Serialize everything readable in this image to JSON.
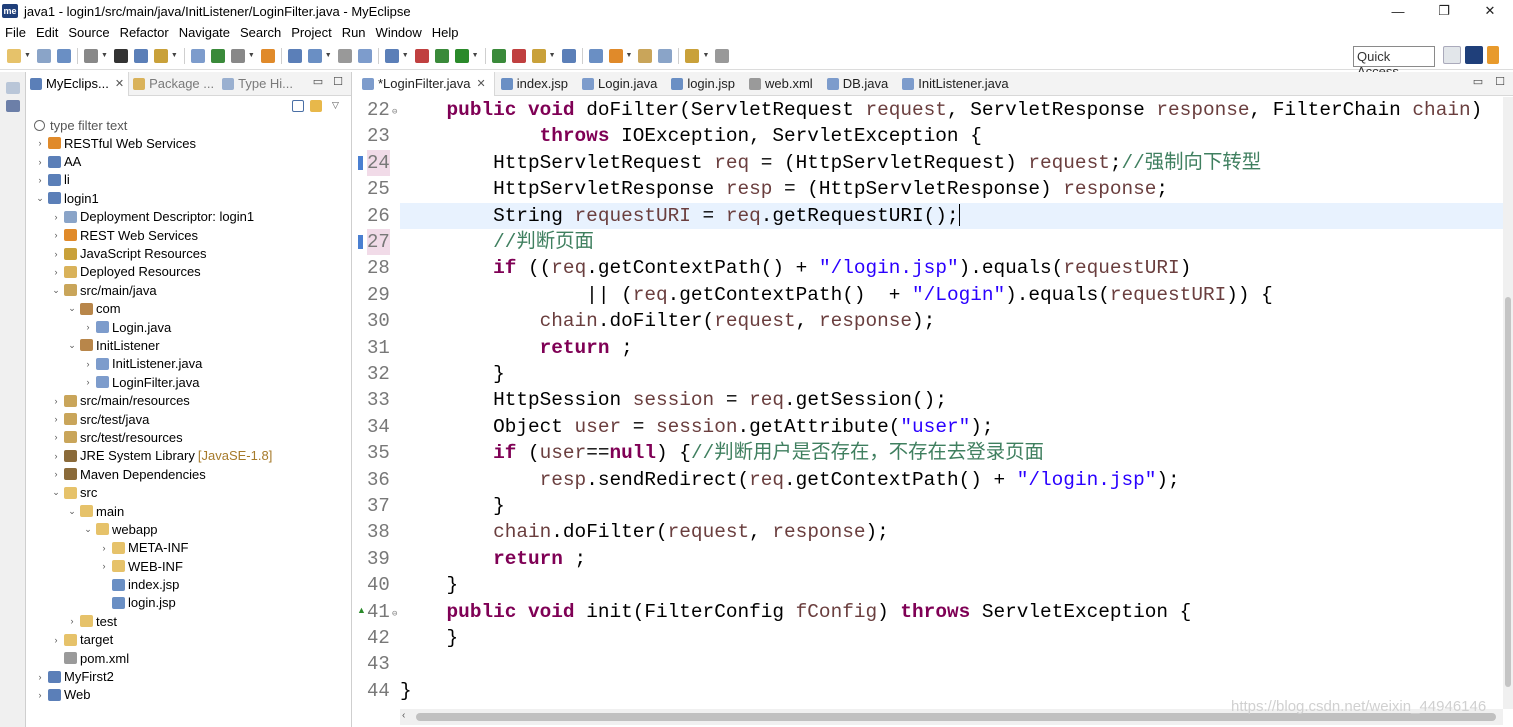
{
  "window": {
    "title": "java1 - login1/src/main/java/InitListener/LoginFilter.java - MyEclipse",
    "app_icon_text": "me",
    "controls": {
      "minimize": "—",
      "maximize": "❐",
      "close": "✕"
    }
  },
  "menu": [
    "File",
    "Edit",
    "Source",
    "Refactor",
    "Navigate",
    "Search",
    "Project",
    "Run",
    "Window",
    "Help"
  ],
  "toolbar": {
    "quick_access_label": "Quick Access"
  },
  "explorer": {
    "tabs": [
      {
        "label": "MyEclips...",
        "active": true
      },
      {
        "label": "Package ...",
        "active": false
      },
      {
        "label": "Type Hi...",
        "active": false
      }
    ],
    "filter_placeholder": "type filter text",
    "tree": [
      {
        "label": "RESTful Web Services",
        "depth": 0,
        "arrow": "›",
        "icon": "rest-icon"
      },
      {
        "label": "AA",
        "depth": 0,
        "arrow": "›",
        "icon": "web-project-icon"
      },
      {
        "label": "li",
        "depth": 0,
        "arrow": "›",
        "icon": "web-project-icon"
      },
      {
        "label": "login1",
        "depth": 0,
        "arrow": "⌄",
        "icon": "web-project-icon"
      },
      {
        "label": "Deployment Descriptor: login1",
        "depth": 1,
        "arrow": "›",
        "icon": "deployment-descriptor-icon"
      },
      {
        "label": "REST Web Services",
        "depth": 1,
        "arrow": "›",
        "icon": "rest-icon"
      },
      {
        "label": "JavaScript Resources",
        "depth": 1,
        "arrow": "›",
        "icon": "javascript-resources-icon"
      },
      {
        "label": "Deployed Resources",
        "depth": 1,
        "arrow": "›",
        "icon": "deployed-resources-icon"
      },
      {
        "label": "src/main/java",
        "depth": 1,
        "arrow": "⌄",
        "icon": "source-folder-icon"
      },
      {
        "label": "com",
        "depth": 2,
        "arrow": "⌄",
        "icon": "package-icon"
      },
      {
        "label": "Login.java",
        "depth": 3,
        "arrow": "›",
        "icon": "java-file-icon"
      },
      {
        "label": "InitListener",
        "depth": 2,
        "arrow": "⌄",
        "icon": "package-icon"
      },
      {
        "label": "InitListener.java",
        "depth": 3,
        "arrow": "›",
        "icon": "java-file-icon"
      },
      {
        "label": "LoginFilter.java",
        "depth": 3,
        "arrow": "›",
        "icon": "java-file-icon"
      },
      {
        "label": "src/main/resources",
        "depth": 1,
        "arrow": "›",
        "icon": "source-folder-icon"
      },
      {
        "label": "src/test/java",
        "depth": 1,
        "arrow": "›",
        "icon": "source-folder-icon"
      },
      {
        "label": "src/test/resources",
        "depth": 1,
        "arrow": "›",
        "icon": "source-folder-icon"
      },
      {
        "label": "JRE System Library",
        "suffix": "[JavaSE-1.8]",
        "depth": 1,
        "arrow": "›",
        "icon": "library-icon"
      },
      {
        "label": "Maven Dependencies",
        "depth": 1,
        "arrow": "›",
        "icon": "library-icon"
      },
      {
        "label": "src",
        "depth": 1,
        "arrow": "⌄",
        "icon": "folder-icon"
      },
      {
        "label": "main",
        "depth": 2,
        "arrow": "⌄",
        "icon": "folder-icon"
      },
      {
        "label": "webapp",
        "depth": 3,
        "arrow": "⌄",
        "icon": "folder-icon"
      },
      {
        "label": "META-INF",
        "depth": 4,
        "arrow": "›",
        "icon": "folder-icon"
      },
      {
        "label": "WEB-INF",
        "depth": 4,
        "arrow": "›",
        "icon": "folder-icon"
      },
      {
        "label": "index.jsp",
        "depth": 4,
        "arrow": "",
        "icon": "jsp-file-icon"
      },
      {
        "label": "login.jsp",
        "depth": 4,
        "arrow": "",
        "icon": "jsp-file-icon"
      },
      {
        "label": "test",
        "depth": 2,
        "arrow": "›",
        "icon": "folder-icon"
      },
      {
        "label": "target",
        "depth": 1,
        "arrow": "›",
        "icon": "folder-icon"
      },
      {
        "label": "pom.xml",
        "depth": 1,
        "arrow": "",
        "icon": "xml-file-icon"
      },
      {
        "label": "MyFirst2",
        "depth": 0,
        "arrow": "›",
        "icon": "web-project-icon"
      },
      {
        "label": "Web",
        "depth": 0,
        "arrow": "›",
        "icon": "web-project-icon"
      }
    ]
  },
  "editor": {
    "tabs": [
      {
        "label": "*LoginFilter.java",
        "active": true,
        "icon": "java-file-icon"
      },
      {
        "label": "index.jsp",
        "active": false,
        "icon": "jsp-file-icon"
      },
      {
        "label": "Login.java",
        "active": false,
        "icon": "java-file-icon"
      },
      {
        "label": "login.jsp",
        "active": false,
        "icon": "jsp-file-icon"
      },
      {
        "label": "web.xml",
        "active": false,
        "icon": "xml-file-icon"
      },
      {
        "label": "DB.java",
        "active": false,
        "icon": "java-file-icon"
      },
      {
        "label": "InitListener.java",
        "active": false,
        "icon": "java-file-icon"
      }
    ],
    "current_line": 26,
    "lines": [
      {
        "num": "22",
        "fold": "⊖",
        "tokens": [
          [
            "",
            "    "
          ],
          [
            "kw",
            "public"
          ],
          [
            "",
            " "
          ],
          [
            "kw",
            "void"
          ],
          [
            "",
            " doFilter(ServletRequest "
          ],
          [
            "var",
            "request"
          ],
          [
            "",
            ", ServletResponse "
          ],
          [
            "var",
            "response"
          ],
          [
            "",
            ", FilterChain "
          ],
          [
            "var",
            "chain"
          ],
          [
            "",
            ")"
          ]
        ]
      },
      {
        "num": "23",
        "tokens": [
          [
            "",
            "            "
          ],
          [
            "kw",
            "throws"
          ],
          [
            "",
            " IOException, ServletException {"
          ]
        ]
      },
      {
        "num": "24",
        "changed": true,
        "tokens": [
          [
            "",
            "        HttpServletRequest "
          ],
          [
            "var",
            "req"
          ],
          [
            "",
            " = (HttpServletRequest) "
          ],
          [
            "var",
            "request"
          ],
          [
            "",
            ";"
          ],
          [
            "cmt",
            "//强制向下转型"
          ]
        ]
      },
      {
        "num": "25",
        "tokens": [
          [
            "",
            "        HttpServletResponse "
          ],
          [
            "var",
            "resp"
          ],
          [
            "",
            " = (HttpServletResponse) "
          ],
          [
            "var",
            "response"
          ],
          [
            "",
            ";"
          ]
        ]
      },
      {
        "num": "26",
        "tokens": [
          [
            "",
            "        String "
          ],
          [
            "var",
            "requestURI"
          ],
          [
            "",
            " = "
          ],
          [
            "var",
            "req"
          ],
          [
            "",
            ".getRequestURI();"
          ]
        ]
      },
      {
        "num": "27",
        "changed": true,
        "tokens": [
          [
            "",
            "        "
          ],
          [
            "cmt",
            "//判断页面"
          ]
        ]
      },
      {
        "num": "28",
        "tokens": [
          [
            "",
            "        "
          ],
          [
            "kw",
            "if"
          ],
          [
            "",
            " (("
          ],
          [
            "var",
            "req"
          ],
          [
            "",
            ".getContextPath() + "
          ],
          [
            "str",
            "\"/login.jsp\""
          ],
          [
            "",
            ").equals("
          ],
          [
            "var",
            "requestURI"
          ],
          [
            "",
            ")"
          ]
        ]
      },
      {
        "num": "29",
        "tokens": [
          [
            "",
            "                || ("
          ],
          [
            "var",
            "req"
          ],
          [
            "",
            ".getContextPath()  + "
          ],
          [
            "str",
            "\"/Login\""
          ],
          [
            "",
            ").equals("
          ],
          [
            "var",
            "requestURI"
          ],
          [
            "",
            ")) {"
          ]
        ]
      },
      {
        "num": "30",
        "tokens": [
          [
            "",
            "            "
          ],
          [
            "var",
            "chain"
          ],
          [
            "",
            ".doFilter("
          ],
          [
            "var",
            "request"
          ],
          [
            "",
            ", "
          ],
          [
            "var",
            "response"
          ],
          [
            "",
            ");"
          ]
        ]
      },
      {
        "num": "31",
        "tokens": [
          [
            "",
            "            "
          ],
          [
            "kw",
            "return"
          ],
          [
            "",
            " ;"
          ]
        ]
      },
      {
        "num": "32",
        "tokens": [
          [
            "",
            "        }"
          ]
        ]
      },
      {
        "num": "33",
        "tokens": [
          [
            "",
            "        HttpSession "
          ],
          [
            "var",
            "session"
          ],
          [
            "",
            " = "
          ],
          [
            "var",
            "req"
          ],
          [
            "",
            ".getSession();"
          ]
        ]
      },
      {
        "num": "34",
        "tokens": [
          [
            "",
            "        Object "
          ],
          [
            "var",
            "user"
          ],
          [
            "",
            " = "
          ],
          [
            "var",
            "session"
          ],
          [
            "",
            ".getAttribute("
          ],
          [
            "str",
            "\"user\""
          ],
          [
            "",
            ");"
          ]
        ]
      },
      {
        "num": "35",
        "tokens": [
          [
            "",
            "        "
          ],
          [
            "kw",
            "if"
          ],
          [
            "",
            " ("
          ],
          [
            "var",
            "user"
          ],
          [
            "",
            "=="
          ],
          [
            "kw",
            "null"
          ],
          [
            "",
            ") {"
          ],
          [
            "cmt",
            "//判断用户是否存在，不存在去登录页面"
          ]
        ]
      },
      {
        "num": "36",
        "tokens": [
          [
            "",
            "            "
          ],
          [
            "var",
            "resp"
          ],
          [
            "",
            ".sendRedirect("
          ],
          [
            "var",
            "req"
          ],
          [
            "",
            ".getContextPath() + "
          ],
          [
            "str",
            "\"/login.jsp\""
          ],
          [
            "",
            ");"
          ]
        ]
      },
      {
        "num": "37",
        "tokens": [
          [
            "",
            "        }"
          ]
        ]
      },
      {
        "num": "38",
        "tokens": [
          [
            "",
            "        "
          ],
          [
            "var",
            "chain"
          ],
          [
            "",
            ".doFilter("
          ],
          [
            "var",
            "request"
          ],
          [
            "",
            ", "
          ],
          [
            "var",
            "response"
          ],
          [
            "",
            ");"
          ]
        ]
      },
      {
        "num": "39",
        "tokens": [
          [
            "",
            "        "
          ],
          [
            "kw",
            "return"
          ],
          [
            "",
            " ;"
          ]
        ]
      },
      {
        "num": "40",
        "tokens": [
          [
            "",
            "    }"
          ]
        ]
      },
      {
        "num": "41",
        "fold": "⊖",
        "marker": "▲",
        "tokens": [
          [
            "",
            "    "
          ],
          [
            "kw",
            "public"
          ],
          [
            "",
            " "
          ],
          [
            "kw",
            "void"
          ],
          [
            "",
            " init(FilterConfig "
          ],
          [
            "var",
            "fConfig"
          ],
          [
            "",
            ") "
          ],
          [
            "kw",
            "throws"
          ],
          [
            "",
            " ServletException {"
          ]
        ]
      },
      {
        "num": "42",
        "tokens": [
          [
            "",
            "    }"
          ]
        ]
      },
      {
        "num": "43",
        "tokens": [
          [
            "",
            ""
          ]
        ]
      },
      {
        "num": "44",
        "tokens": [
          [
            "",
            "}"
          ]
        ]
      }
    ]
  },
  "watermark": "https://blog.csdn.net/weixin_44946146",
  "colors": {
    "keyword": "#7f0055",
    "string": "#2a00ff",
    "variable": "#6a3e3e",
    "comment": "#3f7f5f",
    "current_line": "#e8f2fe"
  }
}
